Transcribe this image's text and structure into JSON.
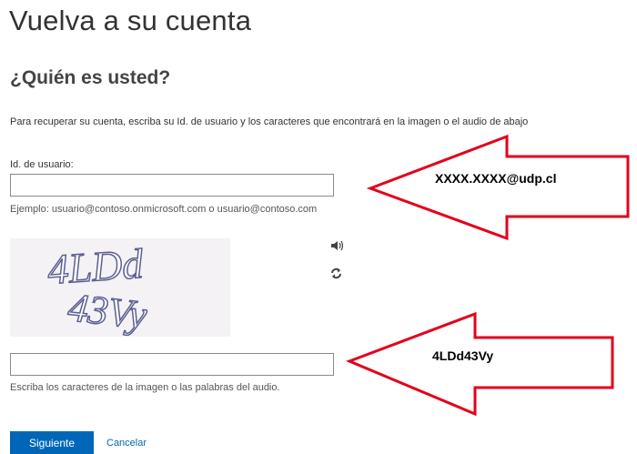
{
  "page": {
    "title": "Vuelva a su cuenta",
    "subtitle": "¿Quién es usted?",
    "intro": "Para recuperar su cuenta, escriba su Id. de usuario y los caracteres que encontrará en la imagen o el audio de abajo"
  },
  "user_id": {
    "label": "Id. de usuario:",
    "value": "",
    "example": "Ejemplo: usuario@contoso.onmicrosoft.com o usuario@contoso.com"
  },
  "captcha": {
    "text": "4LDd43Vy",
    "audio_icon": "speaker-icon",
    "refresh_icon": "refresh-icon"
  },
  "captcha_input": {
    "value": "",
    "hint": "Escriba los caracteres de la imagen o las palabras del audio."
  },
  "actions": {
    "next_label": "Siguiente",
    "cancel_label": "Cancelar"
  },
  "annotations": {
    "arrow_color": "#e3001b",
    "user_id_note": "XXXX.XXXX@udp.cl",
    "captcha_note": "4LDd43Vy"
  }
}
